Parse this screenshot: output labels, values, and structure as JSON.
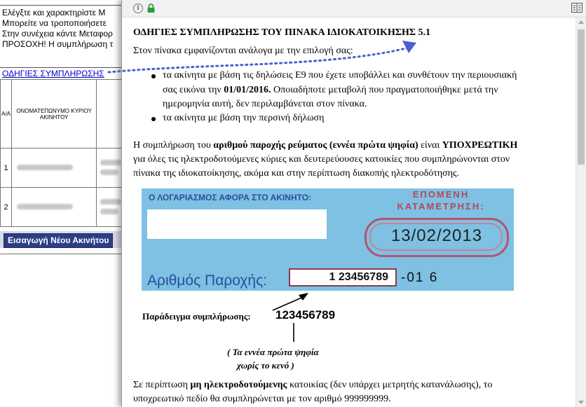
{
  "background_page": {
    "notice_lines": [
      "Ελέγξτε και χαρακτηρίστε Μ",
      "Μπορείτε να τροποποιήσετε",
      "Στην συνέχεια κάντε Μεταφορ",
      "ΠΡΟΣΟΧΗ! Η συμπλήρωση τ"
    ],
    "instructions_link": "ΟΔΗΓΙΕΣ ΣΥΜΠΛΗΡΩΣΗΣ",
    "table": {
      "col_aa": "Α/Α",
      "col_owner": "ΟΝΟΜΑΤΕΠΩΝΥΜΟ ΚΥΡΙΟΥ ΑΚΙΝΗΤΟΥ",
      "rows": [
        "1",
        "2"
      ]
    },
    "add_property_button": "Εισαγωγή Νέου Ακινήτου"
  },
  "popup": {
    "title": "ΟΔΗΓΙΕΣ ΣΥΜΠΛΗΡΩΣΗΣ ΤΟΥ ΠΙΝΑΚΑ ΙΔΙΟΚΑΤΟΙΚΗΣΗΣ 5.1",
    "intro": "Στον πίνακα εμφανίζονται ανάλογα με την επιλογή σας:",
    "bullet1": {
      "line1": "τα ακίνητα με βάση τις δηλώσεις Ε9 που έχετε υποβάλλει και συνθέτουν την περιουσιακή",
      "line2_pre": "σας εικόνα την ",
      "line2_date": "01/01/2016.",
      "line2_post": " Οποιαδήποτε μεταβολή που πραγματοποιήθηκε μετά την",
      "line3": "ημερομηνία αυτή, δεν περιλαμβάνεται στον πίνακα."
    },
    "bullet2": "τα ακίνητα με βάση την περσινή δήλωση",
    "para2": {
      "pre": "Η συμπλήρωση του ",
      "bold1": "αριθμού παροχής ρεύματος (εννέα πρώτα ψηφία)",
      "mid": " είναι ",
      "bold2": "ΥΠΟΧΡΕΩΤΙΚΗ",
      "line2": "για όλες τις ηλεκτροδοτούμενες κύριες και δευτερεύουσες κατοικίες που συμπληρώνονται στον",
      "line3": "πίνακα της ιδιοκατοίκησης, ακόμα και στην περίπτωση διακοπής ηλεκτροδότησης."
    },
    "bill": {
      "account_label": "Ο ΛΟΓΑΡΙΑΣΜΟΣ ΑΦΟΡΑ ΣΤΟ ΑΚΙΝΗΤΟ:",
      "next_reading_line1": "ΕΠΟΜΕΝΗ",
      "next_reading_line2": "ΚΑΤΑΜΕΤΡΗΣΗ:",
      "next_reading_date": "13/02/2013",
      "supply_label": "Αριθμός Παροχής:",
      "supply_number": "1 23456789",
      "supply_suffix": "-01 6"
    },
    "example_label": "Παράδειγμα συμπλήρωσης:",
    "example_value": "123456789",
    "note_line1": "( Τα εννέα πρώτα ψηφία",
    "note_line2": "χωρίς το κενό )",
    "para3": {
      "pre": "Σε περίπτωση ",
      "bold": "μη ηλεκτροδοτούμενης",
      "post": " κατοικίας (δεν υπάρχει μετρητής κατανάλωσης), το",
      "line2": "υποχρεωτικό πεδίο θα συμπληρώνεται με τον αριθμό 999999999."
    }
  },
  "colors": {
    "link": "#0000cc",
    "button": "#2c3e86",
    "bill_background": "#7ec1e2",
    "bill_label": "#2b4e9e",
    "bill_accent": "#b4475c",
    "annotation_arrow": "#4a5fd0"
  }
}
